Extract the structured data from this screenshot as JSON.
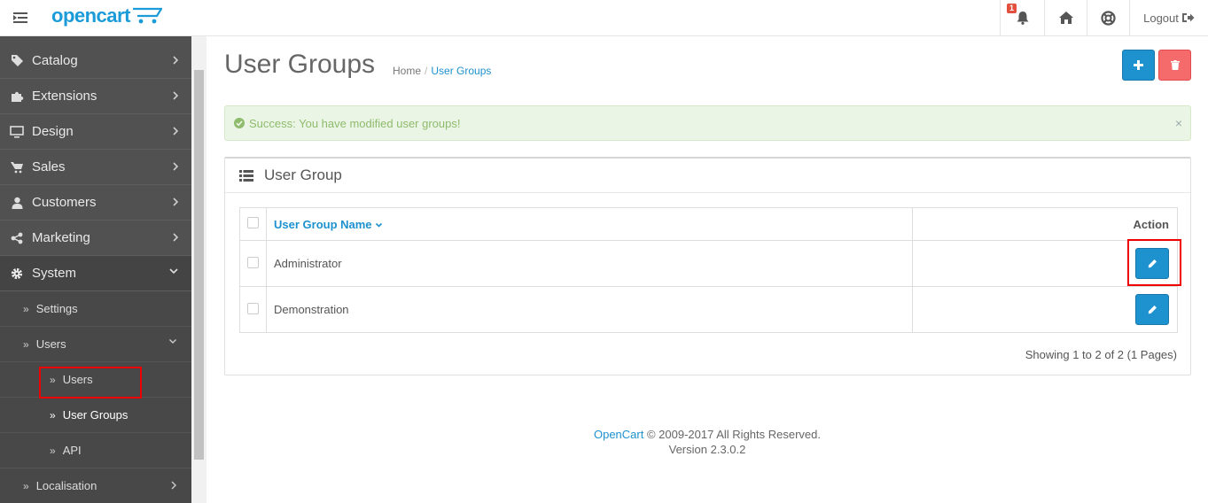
{
  "header": {
    "logo_text": "opencart",
    "notification_count": "1",
    "logout_label": "Logout"
  },
  "sidebar": {
    "items": [
      {
        "label": "Catalog",
        "icon": "tag-icon"
      },
      {
        "label": "Extensions",
        "icon": "puzzle-icon"
      },
      {
        "label": "Design",
        "icon": "monitor-icon"
      },
      {
        "label": "Sales",
        "icon": "cart-icon"
      },
      {
        "label": "Customers",
        "icon": "user-icon"
      },
      {
        "label": "Marketing",
        "icon": "share-icon"
      },
      {
        "label": "System",
        "icon": "gear-icon"
      }
    ],
    "system_sub": {
      "settings": "Settings",
      "users": "Users",
      "users_sub": [
        "Users",
        "User Groups",
        "API"
      ],
      "localisation": "Localisation"
    }
  },
  "page": {
    "title": "User Groups",
    "breadcrumb": [
      "Home",
      "User Groups"
    ],
    "alert": "Success: You have modified user groups!",
    "alert_close": "×",
    "panel_title": "User Group",
    "table": {
      "col_name": "User Group Name",
      "col_action": "Action",
      "rows": [
        "Administrator",
        "Demonstration"
      ]
    },
    "pagination": "Showing 1 to 2 of 2 (1 Pages)"
  },
  "footer": {
    "brand": "OpenCart",
    "copyright": "© 2009-2017 All Rights Reserved.",
    "version": "Version 2.3.0.2"
  },
  "colors": {
    "primary": "#1e91cf",
    "danger": "#f56b6b",
    "sidebar_bg": "#515151",
    "success_text": "#8fbb6c",
    "highlight": "#e00000"
  }
}
